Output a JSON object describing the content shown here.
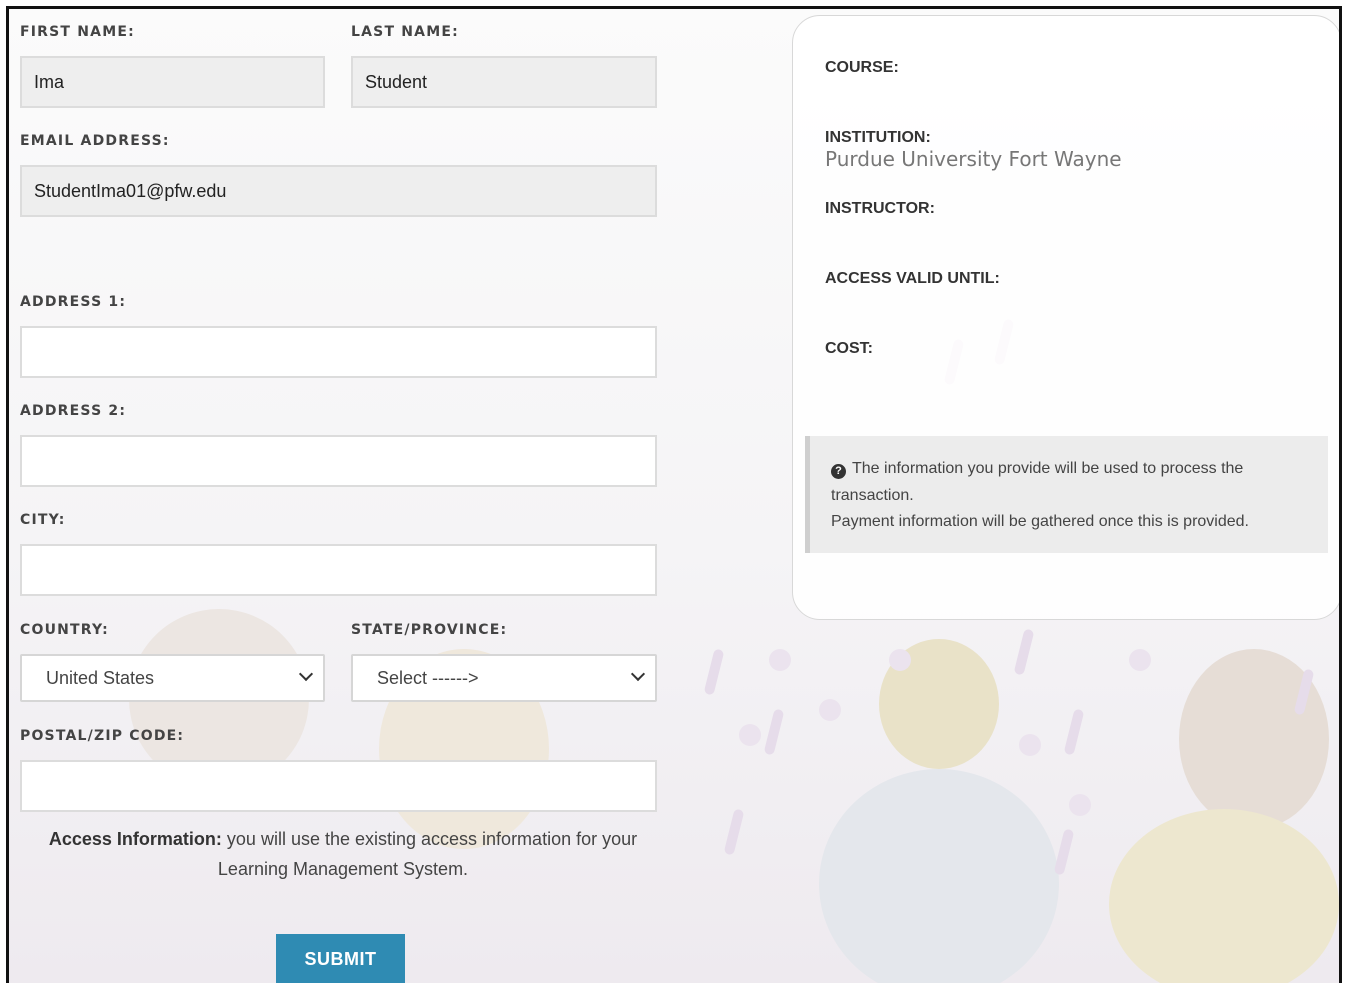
{
  "form": {
    "first_name_label": "FIRST NAME:",
    "first_name_value": "Ima",
    "last_name_label": "LAST NAME:",
    "last_name_value": "Student",
    "email_label": "EMAIL ADDRESS:",
    "email_value": "StudentIma01@pfw.edu",
    "address1_label": "ADDRESS 1:",
    "address1_value": "",
    "address2_label": "ADDRESS 2:",
    "address2_value": "",
    "city_label": "CITY:",
    "city_value": "",
    "country_label": "COUNTRY:",
    "country_value": "United States",
    "state_label": "STATE/PROVINCE:",
    "state_value": "Select ------>",
    "zip_label": "POSTAL/ZIP CODE:",
    "zip_value": "",
    "access_info_bold": "Access Information:",
    "access_info_line1": " you will use the existing access information for your",
    "access_info_line2": "Learning Management System.",
    "submit_label": "SUBMIT"
  },
  "summary": {
    "course_label": "COURSE:",
    "institution_label": "INSTITUTION:",
    "institution_value": "Purdue University Fort Wayne",
    "instructor_label": "INSTRUCTOR:",
    "access_valid_label": "ACCESS VALID UNTIL:",
    "cost_label": "COST:",
    "notice_line1": "The information you provide will be used to process the transaction.",
    "notice_line2": "Payment information will be gathered once this is provided.",
    "notice_icon": "question-circle-icon"
  }
}
